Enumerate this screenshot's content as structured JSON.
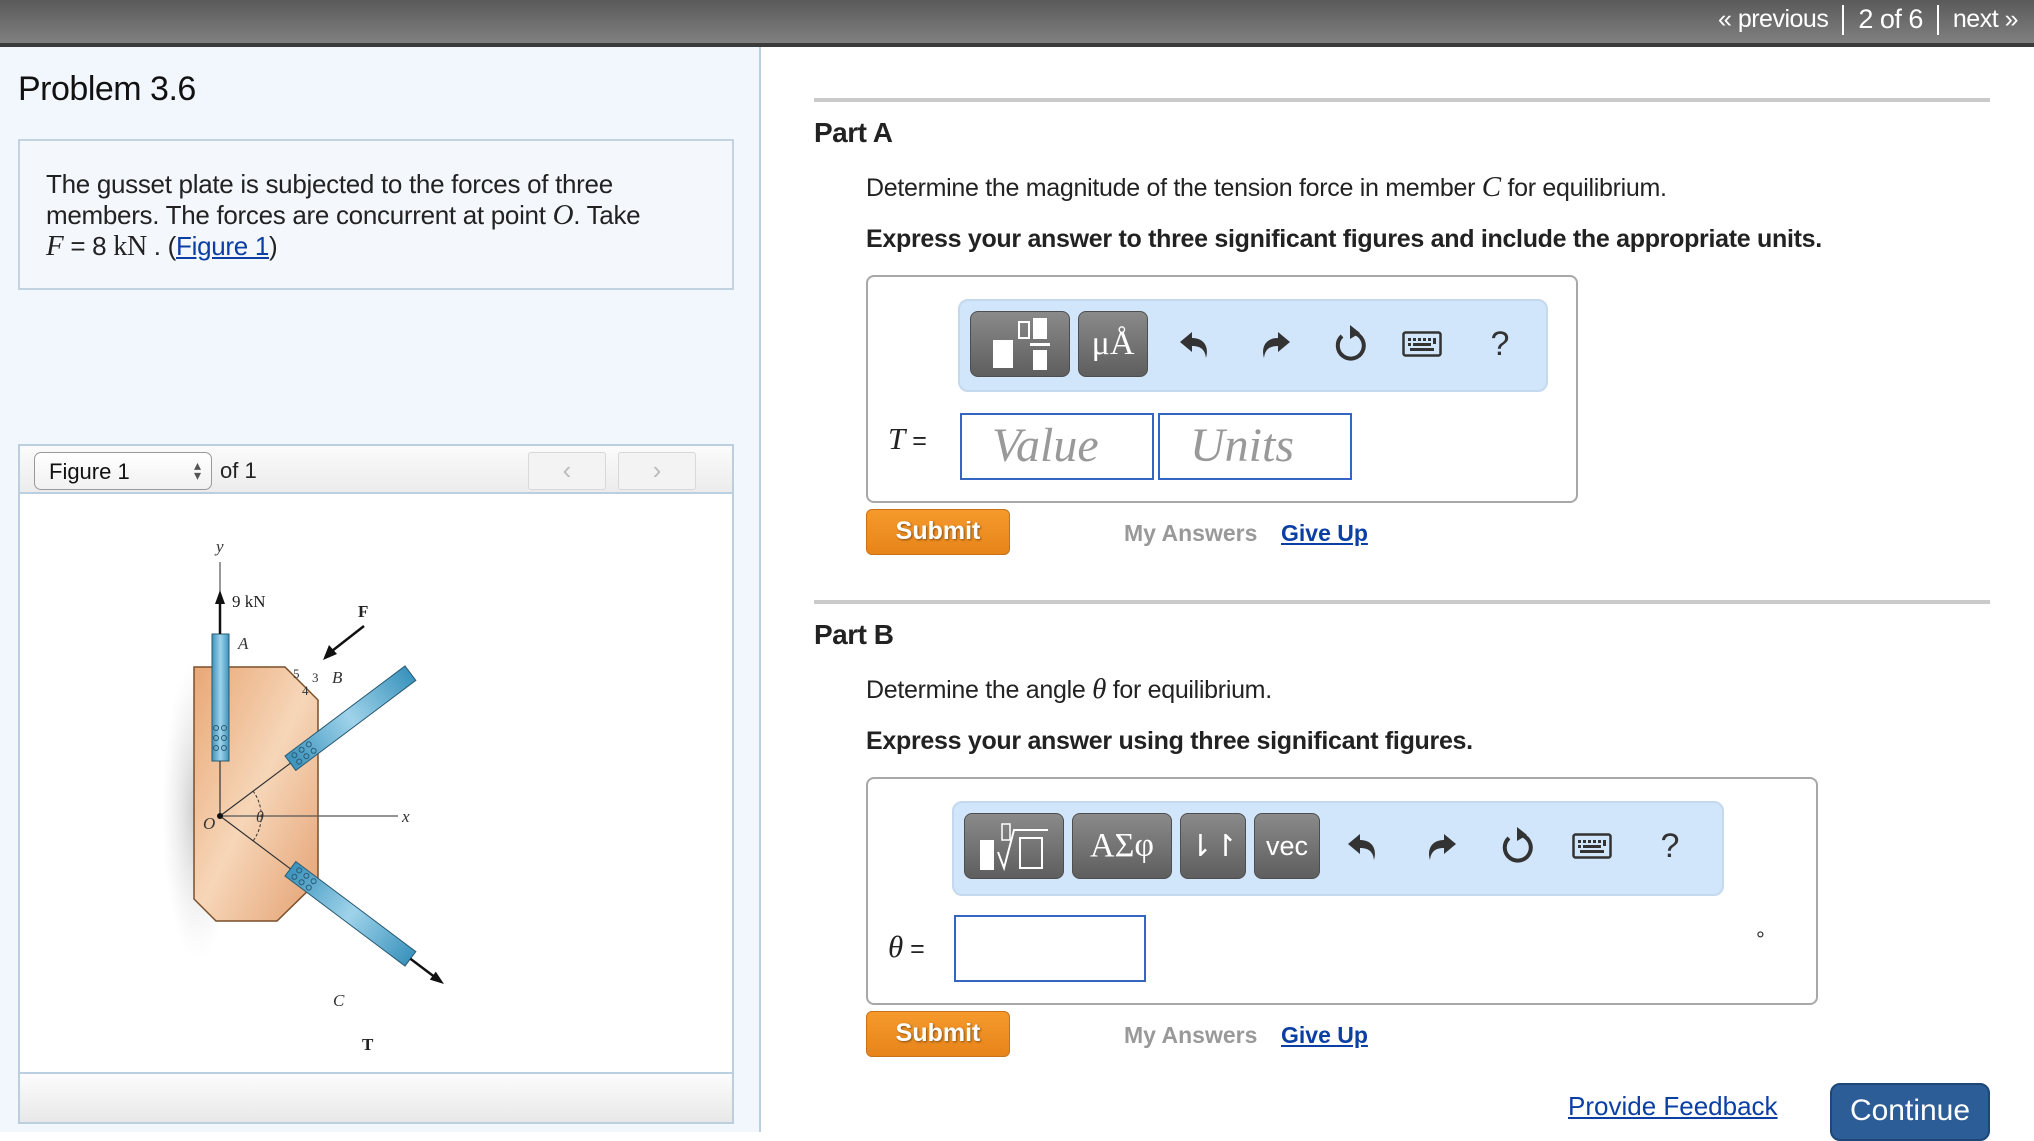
{
  "topnav": {
    "previous": "« previous",
    "position": "2 of 6",
    "next": "next »"
  },
  "problem": {
    "title": "Problem 3.6",
    "desc_line1": "The gusset plate is subjected to the forces of three",
    "desc_line2a": "members. The forces are concurrent at point ",
    "desc_point": "O",
    "desc_line2b": ". Take",
    "desc_var": "F",
    "desc_eq": " = 8 ",
    "desc_unit": "kN",
    "desc_dot": " . (",
    "figure_link": "Figure 1",
    "desc_close": ")"
  },
  "figure": {
    "selected": "Figure 1",
    "of_label": "of 1",
    "prev_icon": "‹",
    "next_icon": "›",
    "labels": {
      "y_axis": "y",
      "x_axis": "x",
      "force_a": "9 kN",
      "member_a": "A",
      "member_b": "B",
      "member_c": "C",
      "force_f": "F",
      "force_t": "T",
      "origin": "O",
      "angle": "θ",
      "slope_5": "5",
      "slope_3": "3",
      "slope_4": "4"
    }
  },
  "partA": {
    "label": "Part A",
    "question_pre": "Determine the magnitude of the tension force in member ",
    "question_var": "C",
    "question_post": " for equilibrium.",
    "instruction": "Express your answer to three significant figures and include the appropriate units.",
    "toolbar": {
      "templates_icon": "templates-icon",
      "units_label": "μÅ",
      "undo_icon": "undo-icon",
      "redo_icon": "redo-icon",
      "reset_icon": "reset-icon",
      "keyboard_icon": "keyboard-icon",
      "help_label": "?"
    },
    "var_label": "T",
    "equals": " =",
    "value_placeholder": "Value",
    "units_placeholder": "Units",
    "submit": "Submit",
    "my_answers": "My Answers",
    "give_up": "Give Up"
  },
  "partB": {
    "label": "Part B",
    "question_pre": "Determine the angle ",
    "question_var": "θ",
    "question_post": " for equilibrium.",
    "instruction": "Express your answer using three significant figures.",
    "toolbar": {
      "templates_icon": "radical-templates-icon",
      "greek_label": "ΑΣφ",
      "arrows_label": "⇂↾",
      "vec_label": "vec",
      "undo_icon": "undo-icon",
      "redo_icon": "redo-icon",
      "reset_icon": "reset-icon",
      "keyboard_icon": "keyboard-icon",
      "help_label": "?"
    },
    "var_label": "θ",
    "equals": " =",
    "value": "",
    "unit": "°",
    "submit": "Submit",
    "my_answers": "My Answers",
    "give_up": "Give Up"
  },
  "footer": {
    "feedback": "Provide Feedback",
    "continue": "Continue"
  }
}
